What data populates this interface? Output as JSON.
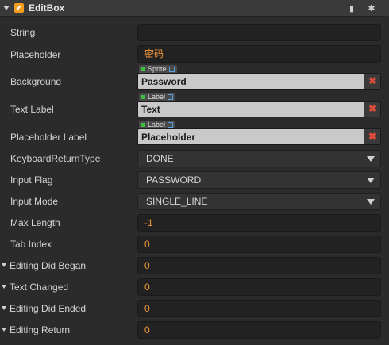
{
  "component": {
    "title": "EditBox",
    "enabled": true
  },
  "rows": {
    "string": {
      "label": "String",
      "value": ""
    },
    "placeholder": {
      "label": "Placeholder",
      "value": "密码"
    },
    "background": {
      "label": "Background",
      "type_tag": "Sprite",
      "value": "Password"
    },
    "text_label": {
      "label": "Text Label",
      "type_tag": "Label",
      "value": "Text"
    },
    "placeholder_label": {
      "label": "Placeholder Label",
      "type_tag": "Label",
      "value": "Placeholder"
    },
    "keyboard_return_type": {
      "label": "KeyboardReturnType",
      "value": "DONE"
    },
    "input_flag": {
      "label": "Input Flag",
      "value": "PASSWORD"
    },
    "input_mode": {
      "label": "Input Mode",
      "value": "SINGLE_LINE"
    },
    "max_length": {
      "label": "Max Length",
      "value": "-1"
    },
    "tab_index": {
      "label": "Tab Index",
      "value": "0"
    },
    "editing_did_began": {
      "label": "Editing Did Began",
      "value": "0"
    },
    "text_changed": {
      "label": "Text Changed",
      "value": "0"
    },
    "editing_did_ended": {
      "label": "Editing Did Ended",
      "value": "0"
    },
    "editing_return": {
      "label": "Editing Return",
      "value": "0"
    }
  },
  "icons": {
    "header_arrow": "chevron-down-icon",
    "enable": "checkbox-icon",
    "help": "book-icon",
    "settings": "gear-icon",
    "clear": "close-icon",
    "link": "link-icon"
  },
  "colors": {
    "accent": "#f39c1d",
    "number": "#f59a3c",
    "clear": "#e04c3c"
  },
  "glyphs": {
    "check": "✔",
    "book": "▮",
    "gear": "✱",
    "clear": "✖"
  }
}
